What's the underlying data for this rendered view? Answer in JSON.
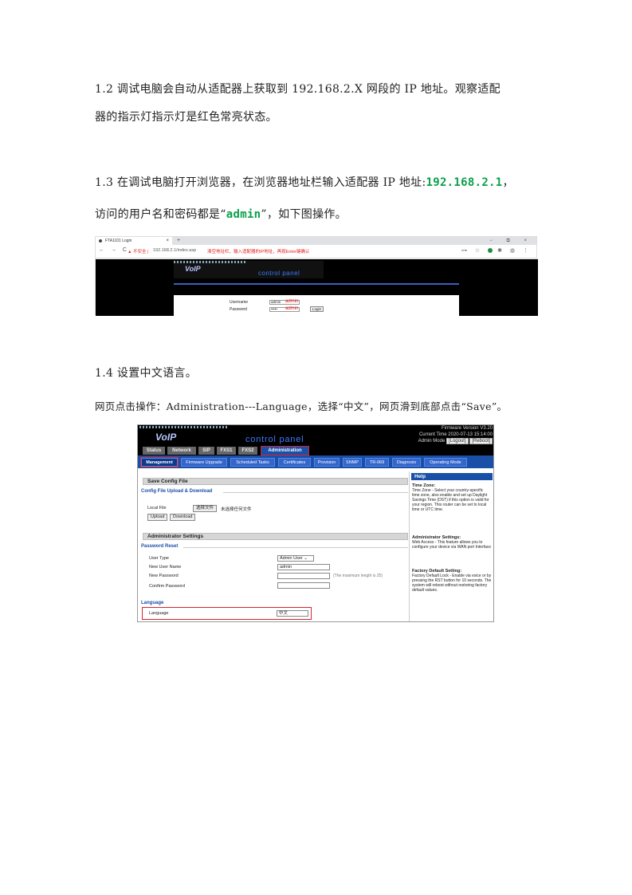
{
  "doc": {
    "p12_line1": "1.2 调试电脑会自动从适配器上获取到 192.168.2.X 网段的 IP 地址。观察适配",
    "p12_line2": "器的指示灯指示灯是红色常亮状态。",
    "p13_line1_a": "1.3 在调试电脑打开浏览器，在浏览器地址栏输入适配器 IP 地址:",
    "p13_ip": "192.168.2.1",
    "p13_line1_b": "，",
    "p13_line2_a": "访问的用户名和密码都是“",
    "p13_admin": "admin",
    "p13_line2_b": "”，如下图操作。",
    "p14_title": "1.4 设置中文语言。",
    "p14_desc": "网页点击操作：Administration---Language，选择“中文”，网页滑到底部点击“Save”。"
  },
  "shot1": {
    "tab_title": "FTA1101 Login",
    "tab_close": "×",
    "new_tab": "+",
    "window_controls": "−  ⧉  ×",
    "nav": "← → C",
    "insecure": "▲ 不安全 |",
    "url": "192.168.2.1/index.asp",
    "annotation": "清空地址栏，输入适配器的IP地址，再按Enter键确认",
    "right_icons": "⊶ ☆",
    "ext_icons": "✱ ◍ ⋮",
    "voip": "VoIP",
    "control_panel": "control panel",
    "username_label": "Username",
    "password_label": "Password",
    "username_value": "admin",
    "password_value": "•••••",
    "username_note": "admin",
    "password_note": "admin",
    "login": "Login"
  },
  "shot2": {
    "firmware": "Firmware Version V3.20",
    "current_time": "Current Time 2020-07-13 15:14:00",
    "mode": "Admin Mode",
    "logout": "[Logout]",
    "reboot": "[Reboot]",
    "voip": "VoIP",
    "control_panel": "control panel",
    "tabs1": [
      "Status",
      "Network",
      "SIP",
      "FXS1",
      "FXS2",
      "Administration"
    ],
    "tabs2": [
      "Management",
      "Firmware Upgrade",
      "Scheduled Tasks",
      "Certificates",
      "Provision",
      "SNMP",
      "TR-069",
      "Diagnosis",
      "Operating Mode"
    ],
    "save_config": "Save Config File",
    "config_upload": "Config File Upload & Download",
    "local_file": "Local File",
    "choose_file": "选择文件",
    "no_file": "未选择任何文件",
    "upload": "Upload",
    "download": "Download",
    "admin_settings": "Administrator Settings",
    "password_reset": "Password Reset",
    "user_type": "User Type",
    "user_type_value": "Admin User ⌄",
    "new_user_name": "New User Name",
    "new_user_value": "admin",
    "new_password": "New Password",
    "max_len": "(The maximum length is 25)",
    "confirm_password": "Confirm Password",
    "language_section": "Language",
    "language_label": "Language",
    "language_value": "中文",
    "help": "Help",
    "help_tz_title": "Time Zone:",
    "help_tz_body": "Time Zone - Select your country-specific time zone, also enable and set up Daylight Savings Time (DST) if this option is valid for your region. This router can be set to local time or UTC time.",
    "help_admin_title": "Administrator Settings:",
    "help_admin_body": "Web Access - This feature allows you to configure your device via WAN port Interface",
    "help_fd_title": "Factory Default Setting:",
    "help_fd_body": "Factory Default Lock - Enable via voice or by pressing the RST button for 10 seconds. The system will reboot without restoring factory default values."
  }
}
